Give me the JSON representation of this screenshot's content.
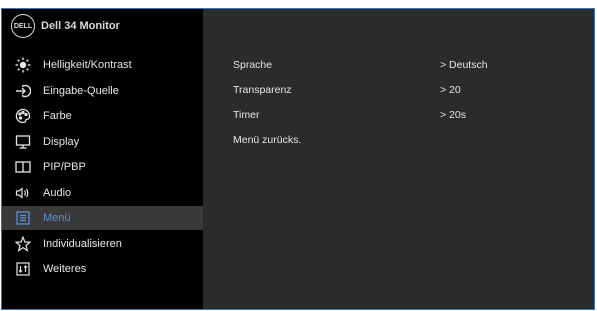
{
  "brand": {
    "logo_text": "DELL",
    "model": "Dell 34 Monitor"
  },
  "colors": {
    "accent": "#5b8fd6",
    "panel": "#2b2b2b",
    "sidebar": "#000000",
    "text": "#e6e6e6",
    "frame": "#3d74b8"
  },
  "sidebar": {
    "items": [
      {
        "label": "Helligkeit/Kontrast",
        "icon": "brightness-icon"
      },
      {
        "label": "Eingabe-Quelle",
        "icon": "input-source-icon"
      },
      {
        "label": "Farbe",
        "icon": "color-palette-icon"
      },
      {
        "label": "Display",
        "icon": "display-icon"
      },
      {
        "label": "PIP/PBP",
        "icon": "pip-pbp-icon"
      },
      {
        "label": "Audio",
        "icon": "audio-icon"
      },
      {
        "label": "Menü",
        "icon": "menu-icon",
        "selected": true
      },
      {
        "label": "Individualisieren",
        "icon": "star-icon"
      },
      {
        "label": "Weiteres",
        "icon": "others-icon"
      }
    ]
  },
  "settings": [
    {
      "name": "Sprache",
      "value": "> Deutsch"
    },
    {
      "name": "Transparenz",
      "value": "> 20"
    },
    {
      "name": "Timer",
      "value": "> 20s"
    },
    {
      "name": "Menü zurücks.",
      "value": ""
    }
  ]
}
